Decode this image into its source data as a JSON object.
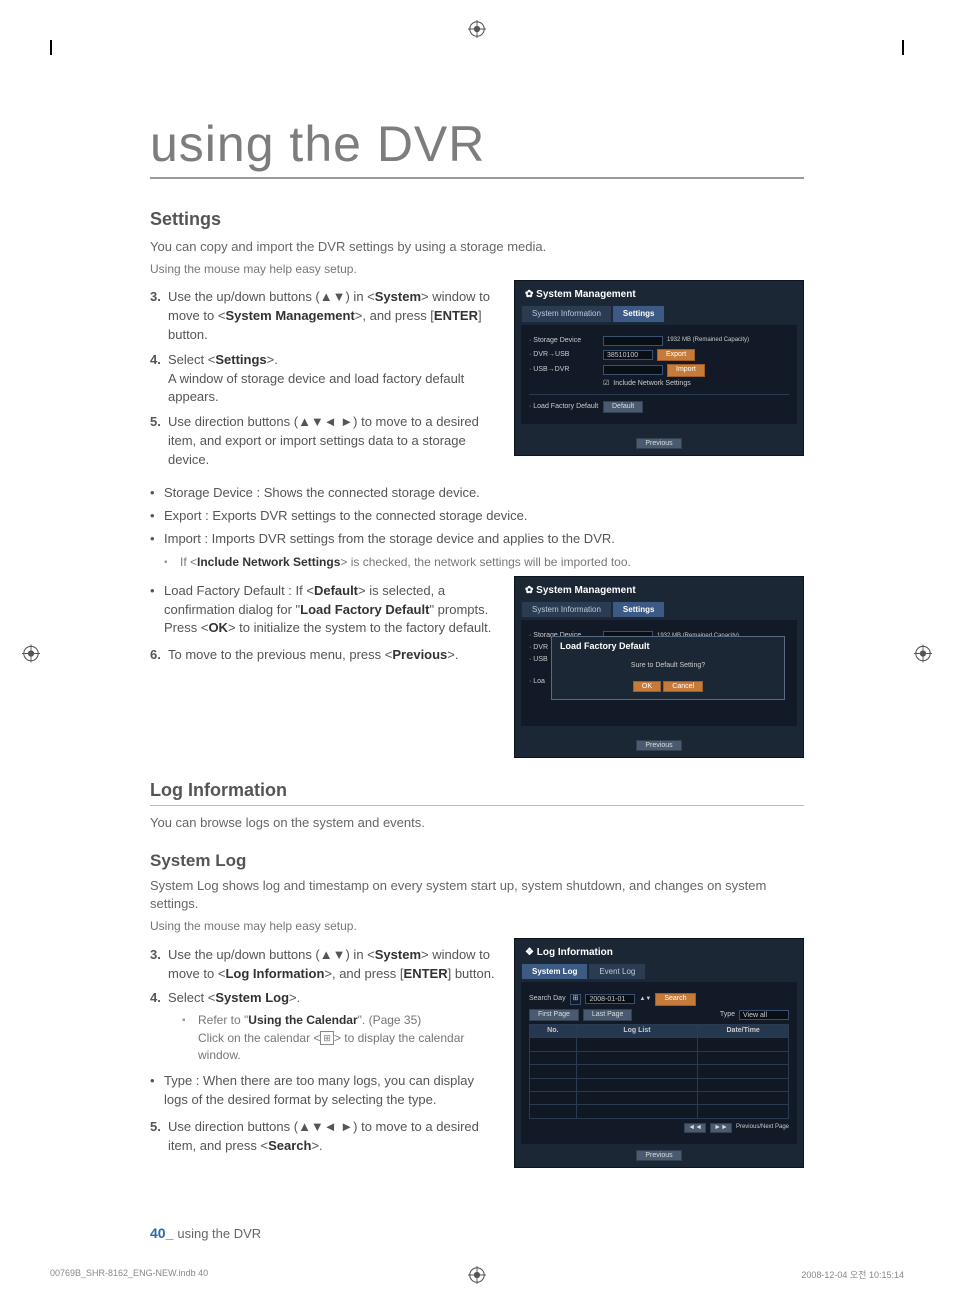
{
  "page": {
    "title": "using the DVR",
    "footer_num": "40_",
    "footer_text": "using the DVR",
    "print_file": "00769B_SHR-8162_ENG-NEW.indb   40",
    "print_date": "2008-12-04   오전 10:15:14"
  },
  "settings": {
    "h2": "Settings",
    "intro1": "You can copy and import the DVR settings by using a storage media.",
    "intro2": "Using the mouse may help easy setup.",
    "step3_pre": "Use the up/down buttons (▲▼) in <",
    "step3_sys": "System",
    "step3_mid": "> window to move to <",
    "step3_mgmt": "System Management",
    "step3_post": ">, and press [",
    "step3_enter": "ENTER",
    "step3_end": "] button.",
    "step4_pre": "Select <",
    "step4_set": "Settings",
    "step4_post": ">.",
    "step4_line2": "A window of storage device and load factory default appears.",
    "step5": "Use direction buttons (▲▼◄ ►) to move to a desired item, and export or import settings data to a storage device.",
    "bul_storage": "Storage Device : Shows the connected storage device.",
    "bul_export": "Export : Exports DVR settings to the connected storage device.",
    "bul_import": "Import : Imports DVR settings from the storage device and applies to the DVR.",
    "sub_include_pre": "If <",
    "sub_include_b": "Include Network Settings",
    "sub_include_post": "> is checked, the network settings will be imported too.",
    "bul_factory_pre": "Load Factory Default : If <",
    "bul_factory_def": "Default",
    "bul_factory_mid": "> is selected, a confirmation dialog for \"",
    "bul_factory_b": "Load Factory Default",
    "bul_factory_post": "\" prompts. Press <",
    "bul_factory_ok": "OK",
    "bul_factory_end": "> to initialize the system to the factory default.",
    "step6_pre": "To move to the previous menu, press <",
    "step6_prev": "Previous",
    "step6_post": ">."
  },
  "shot1": {
    "gear": "✿",
    "title": "System Management",
    "tab1": "System Information",
    "tab2": "Settings",
    "r_storage": "· Storage Device",
    "r_cap": "1932 MB (Remained Capacity)",
    "r_d2u": "· DVR→USB",
    "r_d2u_val": "38510100",
    "btn_export": "Export",
    "r_u2d": "· USB→DVR",
    "btn_import": "Import",
    "chk_lbl": "Include Network Settings",
    "r_lfd": "· Load Factory Default",
    "btn_default": "Default",
    "btn_prev": "Previous"
  },
  "shot2": {
    "gear": "✿",
    "title": "System Management",
    "tab1": "System Information",
    "tab2": "Settings",
    "r_storage": "· Storage Device",
    "r_cap": "1932 MB (Remained Capacity)",
    "r_dvr": "· DVR",
    "r_usb": "· USB",
    "r_loa": "· Loa",
    "dlg_title": "Load Factory Default",
    "dlg_msg": "Sure to Default Setting?",
    "ok": "OK",
    "cancel": "Cancel",
    "btn_prev": "Previous"
  },
  "loginfo": {
    "h2": "Log Information",
    "intro": "You can browse logs on the system and events."
  },
  "syslog": {
    "h3": "System Log",
    "intro1": "System Log shows log and timestamp on every system start up, system shutdown, and changes on system settings.",
    "intro2": "Using the mouse may help easy setup.",
    "step3_pre": "Use the up/down buttons (▲▼) in <",
    "step3_sys": "System",
    "step3_mid": "> window to move to <",
    "step3_li": "Log Information",
    "step3_post": ">, and press [",
    "step3_enter": "ENTER",
    "step3_end": "] button.",
    "step4_pre": "Select <",
    "step4_b": "System Log",
    "step4_post": ">.",
    "sub_a_pre": "Refer to \"",
    "sub_a_b": "Using the Calendar",
    "sub_a_post": "\". (Page 35)",
    "sub_b_pre": "Click on the calendar <",
    "sub_b_post": "> to display the calendar window.",
    "bul_type": "Type : When there are too many logs, you can display logs of the desired format by selecting the type.",
    "step5_pre": "Use direction buttons (▲▼◄ ►) to move to a desired item, and press <",
    "step5_b": "Search",
    "step5_post": ">."
  },
  "shot3": {
    "diamond": "❖",
    "title": "Log Information",
    "tab1": "System Log",
    "tab2": "Event Log",
    "sd_lbl": "Search Day",
    "sd_val": "2008-01-01",
    "btn_search": "Search",
    "fp": "First Page",
    "lp": "Last Page",
    "type_lbl": "Type",
    "type_val": "View all",
    "col_no": "No.",
    "col_list": "Log List",
    "col_dt": "Date/Time",
    "pn": "Previous/Next Page",
    "btn_prev": "Previous"
  }
}
